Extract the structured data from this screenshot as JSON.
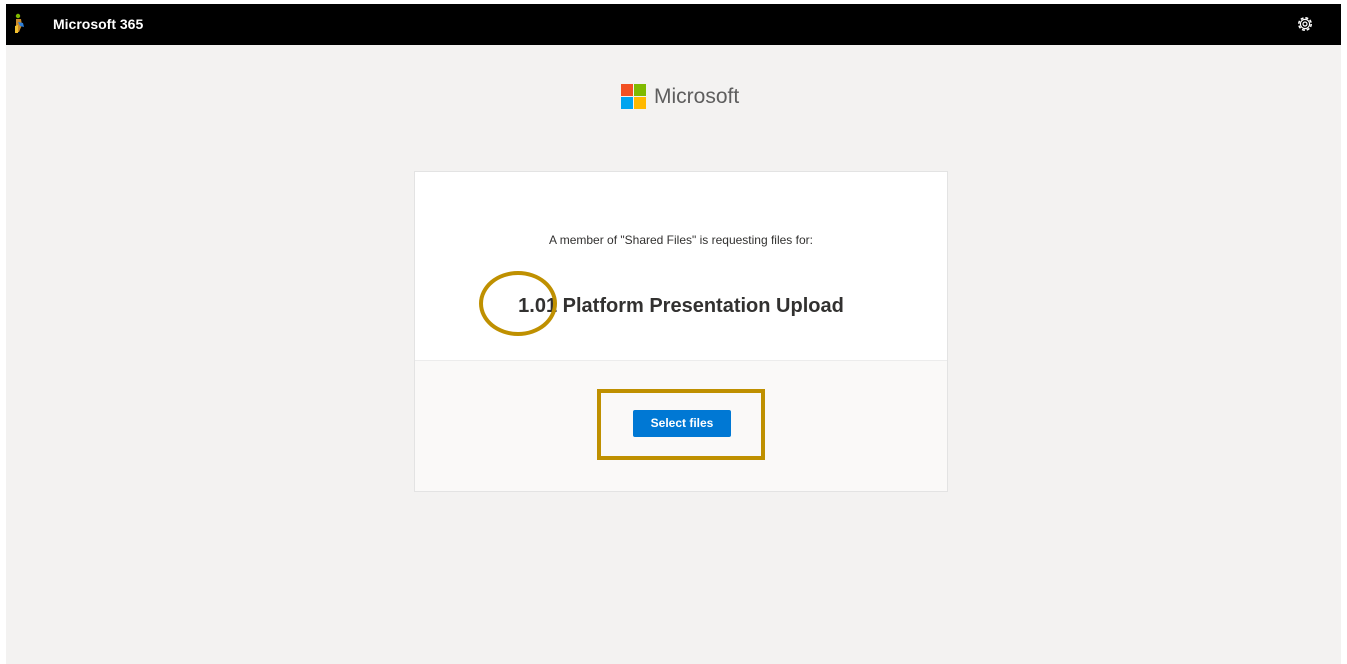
{
  "header": {
    "app_title": "Microsoft 365",
    "logo_icon": "app-logo-icon",
    "settings_icon": "gear-icon"
  },
  "brand": {
    "name": "Microsoft",
    "logo_colors": [
      "#f25022",
      "#7fba00",
      "#00a4ef",
      "#ffb900"
    ]
  },
  "request": {
    "description": "A member of \"Shared Files\" is requesting files for:",
    "title": "1.01 Platform Presentation Upload"
  },
  "actions": {
    "select_files_label": "Select files"
  },
  "colors": {
    "accent": "#0078d4",
    "highlight": "#bf9000",
    "topbar": "#000000"
  }
}
